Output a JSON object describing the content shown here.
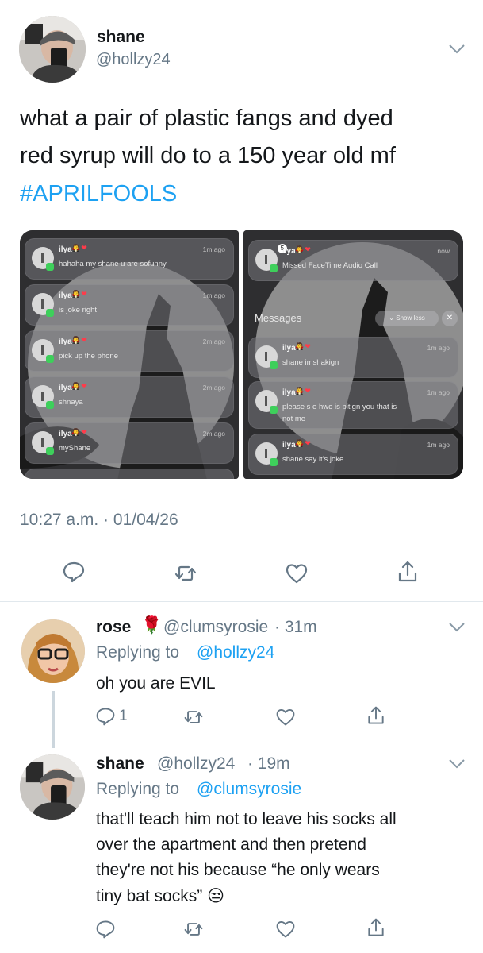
{
  "tweet": {
    "author_name": "shane",
    "author_handle": "@hollzy24",
    "text_line1": "what a pair of plastic fangs and dyed",
    "text_line2": "red syrup will do to a 150 year old mf",
    "hashtag": "#APRILFOOLS",
    "timestamp": "10:27 a.m. · 01/04/26"
  },
  "panel_left": {
    "notifications": [
      {
        "sender": "ilya",
        "time": "1m ago",
        "text": "hahaha my shane u are sofunny"
      },
      {
        "sender": "ilya",
        "time": "1m ago",
        "text": "is joke right"
      },
      {
        "sender": "ilya",
        "time": "2m ago",
        "text": "pick up the phone"
      },
      {
        "sender": "ilya",
        "time": "2m ago",
        "text": "shnaya"
      },
      {
        "sender": "ilya",
        "time": "2m ago",
        "text": "myShane"
      }
    ]
  },
  "panel_right": {
    "top_notification": {
      "sender": "ilya",
      "badge": "5",
      "time": "now",
      "text": "Missed FaceTime Audio Call"
    },
    "messages_header": "Messages",
    "show_less": "Show less",
    "close": "✕",
    "notifications": [
      {
        "sender": "ilya",
        "time": "1m ago",
        "text": "shane imshakign"
      },
      {
        "sender": "ilya",
        "time": "1m ago",
        "text_line1": "please s e hwo is bitign you that is",
        "text_line2": "not me"
      },
      {
        "sender": "ilya",
        "time": "1m ago",
        "text": "shane say it's joke"
      }
    ]
  },
  "reply1": {
    "author_name": "rose",
    "emoji": "🌹",
    "author_handle": "@clumsyrosie",
    "time": "· 31m",
    "replying_prefix": "Replying to",
    "replying_to": "@hollzy24",
    "text": "oh you are EVIL",
    "reply_count": "1"
  },
  "reply2": {
    "author_name": "shane",
    "author_handle": "@hollzy24",
    "time": "· 19m",
    "replying_prefix": "Replying to",
    "replying_to": "@clumsyrosie",
    "text_line1": "that'll teach him not to leave his socks all",
    "text_line2": "over the apartment and then pretend",
    "text_line3": "they're not his because “he only wears",
    "text_line4": "tiny bat socks”",
    "emoji": "😒"
  },
  "colors": {
    "link": "#1da1f2",
    "muted": "#657786",
    "divider": "#e1e8ed"
  },
  "icons": [
    "reply-icon",
    "retweet-icon",
    "like-icon",
    "share-icon",
    "chevron-down-icon"
  ]
}
